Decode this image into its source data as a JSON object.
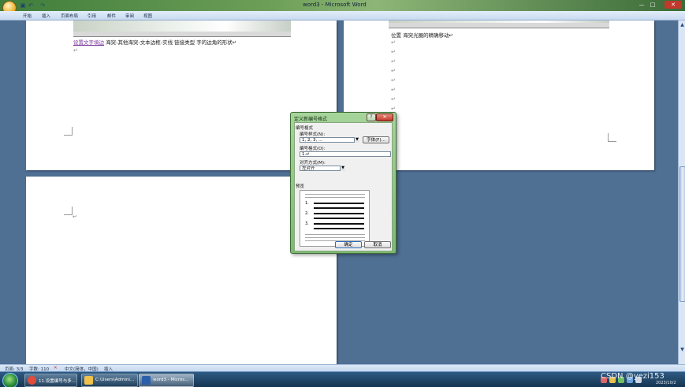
{
  "window": {
    "title": "word3 - Microsoft Word",
    "minimize": "—",
    "maximize": "□",
    "close": "✕"
  },
  "quick_access": {
    "save_icon": "disk-icon",
    "undo_icon": "undo-icon",
    "redo_icon": "redo-icon"
  },
  "ribbon": {
    "tabs": [
      "开始",
      "插入",
      "页面布局",
      "引用",
      "邮件",
      "审阅",
      "视图"
    ]
  },
  "document": {
    "page1_line": {
      "link": "设置文字填边",
      "rest": "  海突-其他海突-文本边框-实线    链接类型    字的边角的形状↵"
    },
    "page2_line": "位置  海突光圈的精确移动↵",
    "para_mark": "↵"
  },
  "dialog": {
    "title": "定义新编号格式",
    "help": "?",
    "close": "✕",
    "group_label": "编号格式",
    "style_label": "编号样式(N):",
    "style_value": "1, 2, 3, …",
    "font_button": "字体(F)...",
    "format_label": "编号格式(O):",
    "format_value": "1.↵",
    "align_label": "对齐方式(M):",
    "align_value": "左对齐",
    "preview_label": "预览",
    "preview_numbers": [
      "1.",
      "2.",
      "3."
    ],
    "ok_button": "确定",
    "cancel_button": "取消"
  },
  "statusbar": {
    "page": "页面: 3/3",
    "words": "字数: 110",
    "language": "中文(简体，中国)",
    "mode": "插入"
  },
  "taskbar": {
    "items": [
      {
        "label": "11.设置编号与多...",
        "icon_color": "#e14b3b"
      },
      {
        "label": "C:\\Users\\Admini...",
        "icon_color": "#f0c14b"
      },
      {
        "label": "word3 - Micros...",
        "icon_color": "#2b5faa"
      }
    ],
    "watermark": "CSDN @yezi153",
    "date": "2023/10/2"
  }
}
